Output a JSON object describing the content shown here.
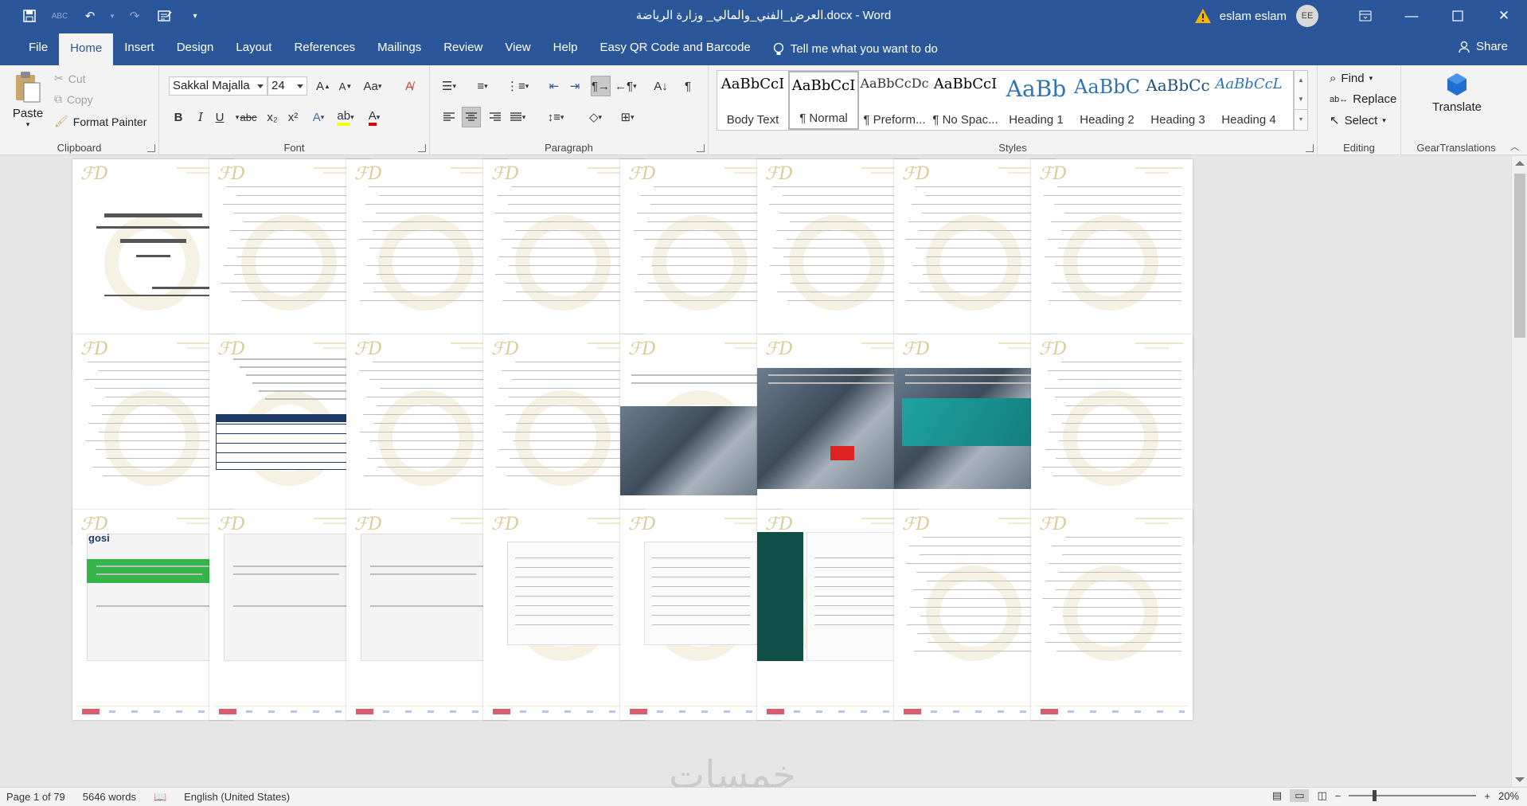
{
  "titlebar": {
    "document_title": "العرض_الفني_والمالي_ وزارة الرياضة.docx  -  Word",
    "user_name": "eslam eslam",
    "user_initials": "EE"
  },
  "tabs": {
    "items": [
      "File",
      "Home",
      "Insert",
      "Design",
      "Layout",
      "References",
      "Mailings",
      "Review",
      "View",
      "Help",
      "Easy QR Code and Barcode"
    ],
    "active": "Home",
    "tell_me": "Tell me what you want to do",
    "share": "Share"
  },
  "clipboard": {
    "paste": "Paste",
    "cut": "Cut",
    "copy": "Copy",
    "format_painter": "Format Painter",
    "label": "Clipboard"
  },
  "font": {
    "family": "Sakkal Majalla",
    "size": "24",
    "change_case": "Aa",
    "bold": "B",
    "italic": "I",
    "underline": "U",
    "strike": "abc",
    "subscript": "x₂",
    "superscript": "x²",
    "label": "Font"
  },
  "paragraph": {
    "label": "Paragraph"
  },
  "styles": {
    "items": [
      {
        "sample": "AaBbCcI",
        "name": "Body Text",
        "size": 18,
        "color": "#000000"
      },
      {
        "sample": "AaBbCcI",
        "name": "¶ Normal",
        "size": 18,
        "color": "#000000"
      },
      {
        "sample": "AaBbCcDc",
        "name": "¶ Preform...",
        "size": 16,
        "color": "#333333"
      },
      {
        "sample": "AaBbCcI",
        "name": "¶ No Spac...",
        "size": 18,
        "color": "#000000"
      },
      {
        "sample": "AaBb",
        "name": "Heading 1",
        "size": 28,
        "color": "#2e74b5"
      },
      {
        "sample": "AaBbC",
        "name": "Heading 2",
        "size": 24,
        "color": "#2e74b5"
      },
      {
        "sample": "AaBbCc",
        "name": "Heading 3",
        "size": 20,
        "color": "#1f4e79"
      },
      {
        "sample": "AaBbCcL",
        "name": "Heading 4",
        "size": 18,
        "color": "#2e74b5"
      }
    ],
    "label": "Styles"
  },
  "editing": {
    "find": "Find",
    "replace": "Replace",
    "select": "Select",
    "label": "Editing"
  },
  "gear": {
    "translate": "Translate",
    "label": "GearTranslations"
  },
  "status": {
    "page": "Page 1 of 79",
    "words": "5646 words",
    "language": "English (United States)",
    "zoom": "20%"
  },
  "watermark_text": "خمسات",
  "colors": {
    "accent": "#2b579a",
    "ribbon_bg": "#f3f3f3",
    "doc_bg": "#e6e6e6"
  }
}
